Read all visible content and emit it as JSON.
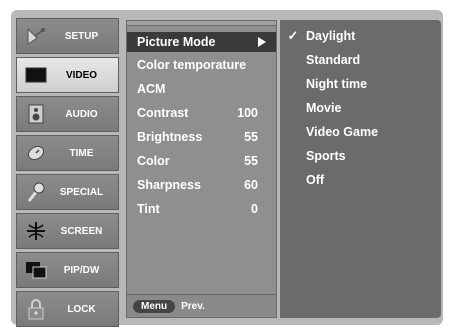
{
  "sidebar": {
    "items": [
      {
        "label": "SETUP",
        "icon": "satellite-dish-icon",
        "selected": false
      },
      {
        "label": "VIDEO",
        "icon": "tv-screen-icon",
        "selected": true
      },
      {
        "label": "AUDIO",
        "icon": "speaker-icon",
        "selected": false
      },
      {
        "label": "TIME",
        "icon": "clock-icon",
        "selected": false
      },
      {
        "label": "SPECIAL",
        "icon": "special-tool-icon",
        "selected": false
      },
      {
        "label": "SCREEN",
        "icon": "screen-adjust-icon",
        "selected": false
      },
      {
        "label": "PIP/DW",
        "icon": "pip-window-icon",
        "selected": false
      },
      {
        "label": "LOCK",
        "icon": "padlock-icon",
        "selected": false
      }
    ]
  },
  "menu": {
    "items": [
      {
        "label": "Picture Mode",
        "value": "",
        "selected": true
      },
      {
        "label": "Color temporature",
        "value": ""
      },
      {
        "label": "ACM",
        "value": ""
      },
      {
        "label": "Contrast",
        "value": "100"
      },
      {
        "label": "Brightness",
        "value": "55"
      },
      {
        "label": "Color",
        "value": "55"
      },
      {
        "label": "Sharpness",
        "value": "60"
      },
      {
        "label": "Tint",
        "value": "0"
      }
    ],
    "footer": {
      "button_label": "Menu",
      "prev_label": "Prev."
    }
  },
  "submenu": {
    "check_mark": "✓",
    "items": [
      {
        "label": "Daylight",
        "checked": true
      },
      {
        "label": "Standard",
        "checked": false
      },
      {
        "label": "Night time",
        "checked": false
      },
      {
        "label": "Movie",
        "checked": false
      },
      {
        "label": "Video Game",
        "checked": false
      },
      {
        "label": "Sports",
        "checked": false
      },
      {
        "label": "Off",
        "checked": false
      }
    ]
  },
  "colors": {
    "selected_menu_bg": "#3a3a3a",
    "submenu_bg": "#6b6b6b",
    "menu_bg": "#8f8f8f",
    "sidebar_selected_bg": "#e0e0e0"
  }
}
